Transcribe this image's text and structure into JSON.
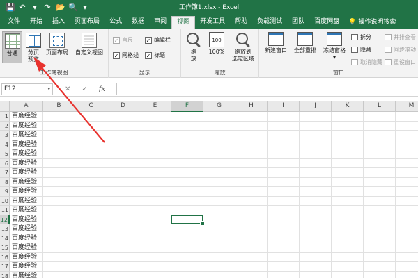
{
  "window": {
    "title": "工作簿1.xlsx - Excel"
  },
  "quick_access": [
    {
      "name": "save-icon",
      "glyph": "💾"
    },
    {
      "name": "undo-icon",
      "glyph": "↶"
    },
    {
      "name": "undo-dropdown-icon",
      "glyph": "▾"
    },
    {
      "name": "redo-icon",
      "glyph": "↷"
    },
    {
      "name": "open-folder-icon",
      "glyph": "📂"
    },
    {
      "name": "print-preview-icon",
      "glyph": "🔍"
    },
    {
      "name": "customize-qa-icon",
      "glyph": "▾"
    }
  ],
  "tabs": [
    "文件",
    "开始",
    "插入",
    "页面布局",
    "公式",
    "数据",
    "审阅",
    "视图",
    "开发工具",
    "帮助",
    "负载测试",
    "团队",
    "百度网盘"
  ],
  "active_tab_index": 7,
  "tell_me": "操作说明搜索",
  "ribbon": {
    "workbook_views": {
      "label": "工作簿视图",
      "normal": "普通",
      "page_break_line1": "分页",
      "page_break_line2": "预览",
      "page_layout": "页面布局",
      "custom_views": "自定义视图"
    },
    "show": {
      "label": "显示",
      "ruler": "直尺",
      "formula_bar": "编辑栏",
      "gridlines": "网格线",
      "headings": "标题"
    },
    "zoom": {
      "label": "缩放",
      "zoom_line1": "缩",
      "zoom_line2": "放",
      "hundred": "100%",
      "hundred_icon_text": "100",
      "zoom_selection_line1": "缩放到",
      "zoom_selection_line2": "选定区域"
    },
    "window": {
      "label": "窗口",
      "new_window": "新建窗口",
      "arrange_all": "全部重排",
      "freeze_panes": "冻结窗格",
      "split": "拆分",
      "hide": "隐藏",
      "unhide": "取消隐藏",
      "side_by_side": "并排查看",
      "sync_scroll": "同步滚动",
      "reset_position": "重设窗口"
    }
  },
  "formula_bar": {
    "name_box": "F12",
    "cancel": "✕",
    "enter": "✓",
    "fx": "fx"
  },
  "columns": [
    "A",
    "B",
    "C",
    "D",
    "E",
    "F",
    "G",
    "H",
    "I",
    "J",
    "K",
    "L",
    "M"
  ],
  "active_column": "F",
  "active_row": 12,
  "rows": [
    {
      "num": "1",
      "a": "百度经验"
    },
    {
      "num": "2",
      "a": "百度经验"
    },
    {
      "num": "3",
      "a": "百度经验"
    },
    {
      "num": "4",
      "a": "百度经验"
    },
    {
      "num": "5",
      "a": "百度经验"
    },
    {
      "num": "6",
      "a": "百度经验"
    },
    {
      "num": "7",
      "a": "百度经验"
    },
    {
      "num": "8",
      "a": "百度经验"
    },
    {
      "num": "9",
      "a": "百度经验"
    },
    {
      "num": "10",
      "a": "百度经验"
    },
    {
      "num": "11",
      "a": "百度经验"
    },
    {
      "num": "12",
      "a": "百度经验"
    },
    {
      "num": "13",
      "a": "百度经验"
    },
    {
      "num": "14",
      "a": "百度经验"
    },
    {
      "num": "15",
      "a": "百度经验"
    },
    {
      "num": "16",
      "a": "百度经验"
    },
    {
      "num": "17",
      "a": "百度经验"
    },
    {
      "num": "18",
      "a": "百度经验"
    }
  ],
  "colors": {
    "excel_green": "#217346",
    "arrow_red": "#e8322e"
  }
}
